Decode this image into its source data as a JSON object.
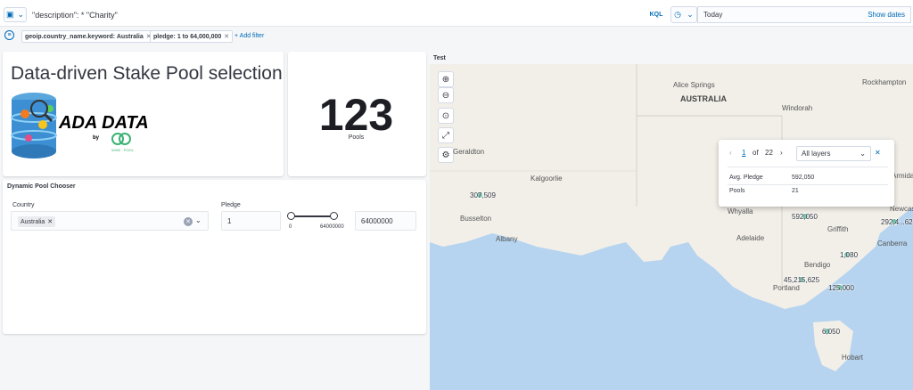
{
  "query": {
    "text": "\"description\": * \"Charity\"",
    "language": "KQL"
  },
  "date": {
    "value": "Today",
    "show_dates": "Show dates"
  },
  "filters": [
    {
      "label": "geoip.country_name.keyword: Australia"
    },
    {
      "label": "pledge: 1 to 64,000,000"
    }
  ],
  "add_filter": "+ Add filter",
  "title_panel": {
    "title": "Data-driven Stake Pool selection",
    "logo_text": "ADA DATA",
    "logo_by": "by",
    "logo_sub": "WISE · POOL"
  },
  "metric": {
    "value": "123",
    "label": "Pools"
  },
  "chooser": {
    "title": "Dynamic Pool Chooser",
    "country_label": "Country",
    "country_value": "Australia",
    "pledge_label": "Pledge",
    "pledge_min": "1",
    "pledge_max": "64000000",
    "range_min_tick": "0",
    "range_max_tick": "64000000"
  },
  "map": {
    "title": "Test",
    "cities": [
      "Alice Springs",
      "AUSTRALIA",
      "Windorah",
      "Rockhampton",
      "Geraldton",
      "Kalgoorlie",
      "Busselton",
      "Albany",
      "Whyalla",
      "Adelaide",
      "Griffith",
      "Canberra",
      "Newcas",
      "Armida",
      "Bendigo",
      "Portland",
      "Hobart"
    ],
    "clusters": [
      "307,509",
      "592,050",
      "292,4...62",
      "1,080",
      "45,215,625",
      "125,000",
      "6,050"
    ],
    "popup": {
      "page": "1",
      "of": "of",
      "total": "22",
      "layers": "All layers",
      "rows": [
        {
          "k": "Avg. Pledge",
          "v": "592,050"
        },
        {
          "k": "Pools",
          "v": "21"
        }
      ]
    }
  }
}
